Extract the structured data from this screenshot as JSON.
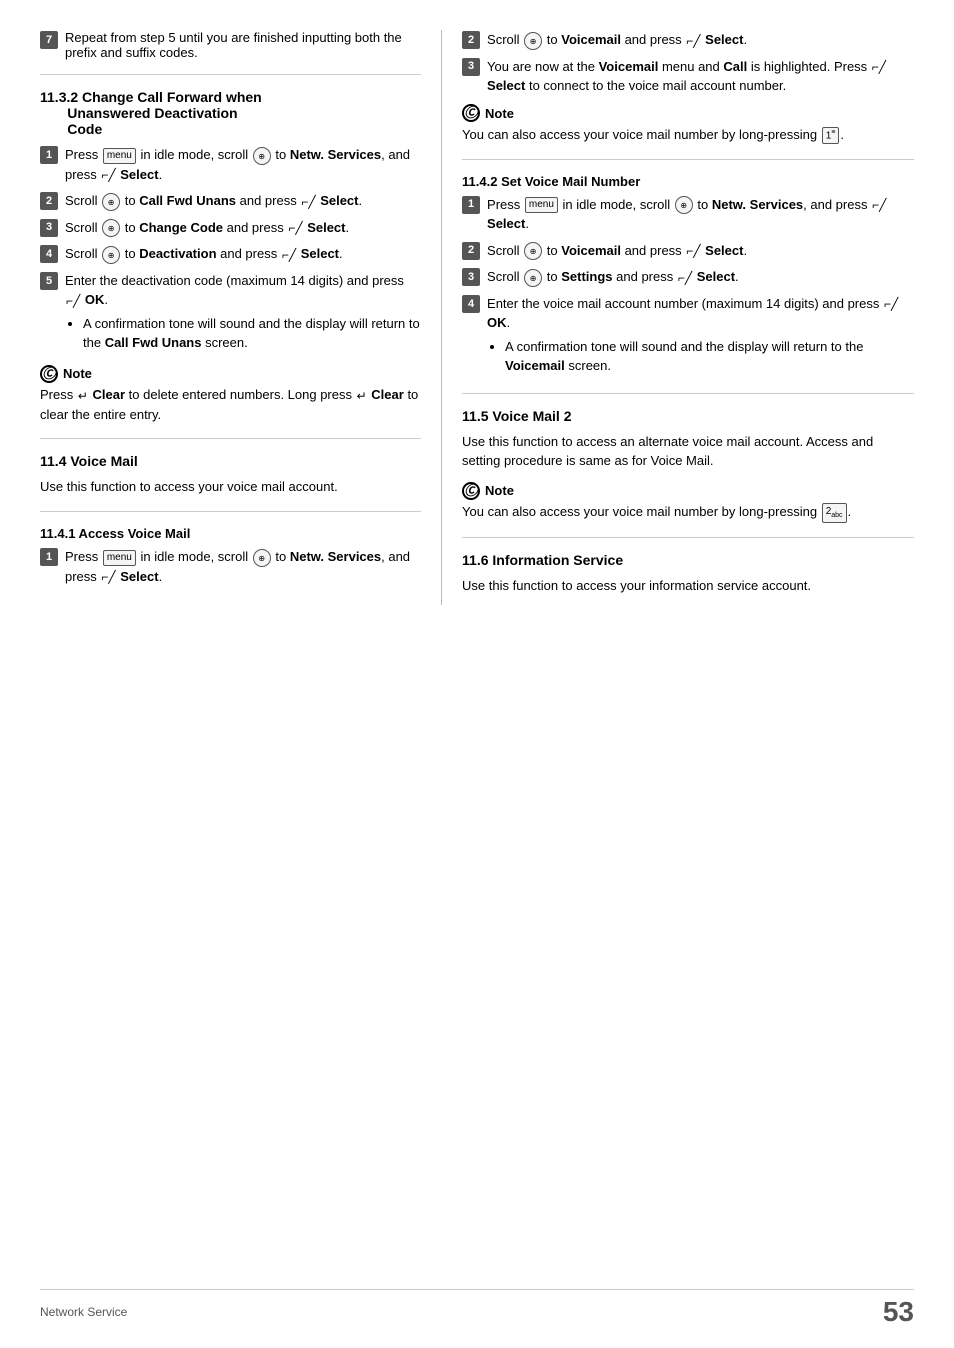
{
  "page": {
    "footer_label": "Network Service",
    "footer_page": "53"
  },
  "left_col": {
    "step7": {
      "text": "Repeat from step 5 until you are finished inputting both the prefix and suffix codes."
    },
    "section_1132": {
      "title": "11.3.2 Change Call Forward when Unanswered Deactivation Code",
      "steps": [
        {
          "num": "1",
          "text": "Press [menu] in idle mode, scroll ⊕ to Netw. Services, and press ⌐ Select."
        },
        {
          "num": "2",
          "text": "Scroll ⊕ to Call Fwd Unans and press ⌐ Select."
        },
        {
          "num": "3",
          "text": "Scroll ⊕ to Change Code and press ⌐ Select."
        },
        {
          "num": "4",
          "text": "Scroll ⊕ to Deactivation and press ⌐ Select."
        },
        {
          "num": "5",
          "text": "Enter the deactivation code (maximum 14 digits) and press ⌐ OK.",
          "bullet": "A confirmation tone will sound and the display will return to the Call Fwd Unans screen."
        }
      ],
      "note": {
        "title": "Note",
        "text": "Press ↵ Clear to delete entered numbers. Long press ↵ Clear to clear the entire entry."
      }
    },
    "section_114": {
      "title": "11.4    Voice Mail",
      "text": "Use this function to access your voice mail account."
    },
    "section_1141": {
      "title": "11.4.1 Access Voice Mail",
      "steps": [
        {
          "num": "1",
          "text": "Press [menu] in idle mode, scroll ⊕ to Netw. Services, and press ⌐ Select."
        }
      ]
    }
  },
  "right_col": {
    "section_1141_cont": {
      "steps": [
        {
          "num": "2",
          "text": "Scroll ⊕ to Voicemail and press ⌐ Select."
        },
        {
          "num": "3",
          "text": "You are now at the Voicemail menu and Call is highlighted. Press ⌐ Select to connect to the voice mail account number."
        }
      ],
      "note": {
        "title": "Note",
        "text": "You can also access your voice mail number by long-pressing [1]."
      }
    },
    "section_1142": {
      "title": "11.4.2 Set Voice Mail Number",
      "steps": [
        {
          "num": "1",
          "text": "Press [menu] in idle mode, scroll ⊕ to Netw. Services, and press ⌐ Select."
        },
        {
          "num": "2",
          "text": "Scroll ⊕ to Voicemail and press ⌐ Select."
        },
        {
          "num": "3",
          "text": "Scroll ⊕ to Settings and press ⌐ Select."
        },
        {
          "num": "4",
          "text": "Enter the voice mail account number (maximum 14 digits) and press ⌐ OK.",
          "bullet": "A confirmation tone will sound and the display will return to the Voicemail screen."
        }
      ]
    },
    "section_115": {
      "title": "11.5    Voice Mail 2",
      "text": "Use this function to access an alternate voice mail account. Access and setting procedure is same as for Voice Mail.",
      "note": {
        "title": "Note",
        "text": "You can also access your voice mail number by long-pressing [2]."
      }
    },
    "section_116": {
      "title": "11.6    Information Service",
      "text": "Use this function to access your information service account."
    }
  }
}
